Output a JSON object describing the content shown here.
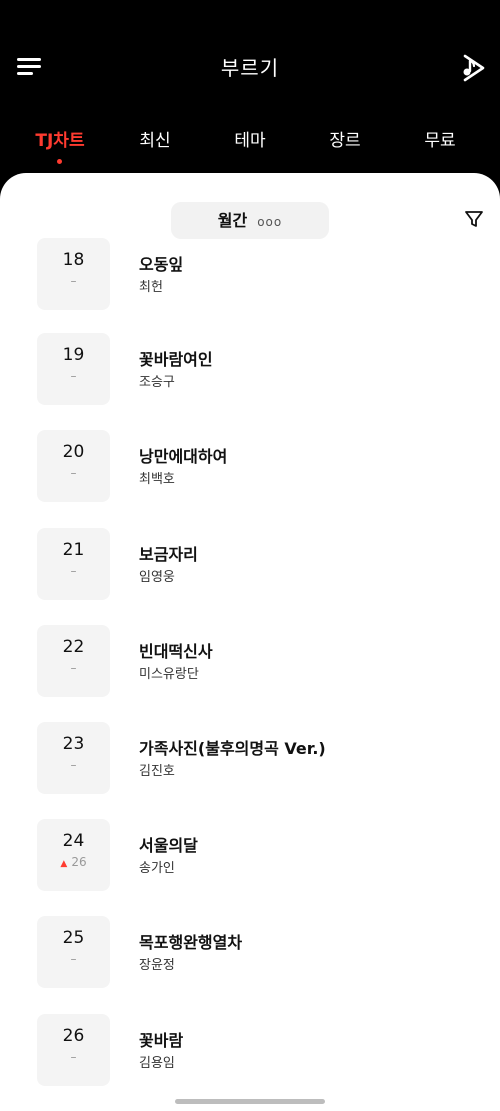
{
  "header": {
    "title": "부르기",
    "menu_icon": "hamburger-menu-icon",
    "play_icon": "music-play-icon"
  },
  "tabs": [
    {
      "label": "TJ차트",
      "active": true
    },
    {
      "label": "최신",
      "active": false
    },
    {
      "label": "테마",
      "active": false
    },
    {
      "label": "장르",
      "active": false
    },
    {
      "label": "무료",
      "active": false
    }
  ],
  "period": {
    "label": "월간",
    "more": "ooo"
  },
  "filter_icon": "filter-icon",
  "songs": [
    {
      "rank": "18",
      "change": "–",
      "title": "오동잎",
      "artist": "최헌"
    },
    {
      "rank": "19",
      "change": "–",
      "title": "꽃바람여인",
      "artist": "조승구"
    },
    {
      "rank": "20",
      "change": "–",
      "title": "낭만에대하여",
      "artist": "최백호"
    },
    {
      "rank": "21",
      "change": "–",
      "title": "보금자리",
      "artist": "임영웅"
    },
    {
      "rank": "22",
      "change": "–",
      "title": "빈대떡신사",
      "artist": "미스유랑단"
    },
    {
      "rank": "23",
      "change": "–",
      "title": "가족사진(불후의명곡 Ver.)",
      "artist": "김진호"
    },
    {
      "rank": "24",
      "change": "26",
      "change_dir": "up",
      "title": "서울의달",
      "artist": "송가인"
    },
    {
      "rank": "25",
      "change": "–",
      "title": "목포행완행열차",
      "artist": "장윤정"
    },
    {
      "rank": "26",
      "change": "–",
      "title": "꽃바람",
      "artist": "김용임"
    }
  ],
  "colors": {
    "accent": "#ff3b30",
    "header_bg": "#000000",
    "rank_box_bg": "#f4f4f4"
  }
}
